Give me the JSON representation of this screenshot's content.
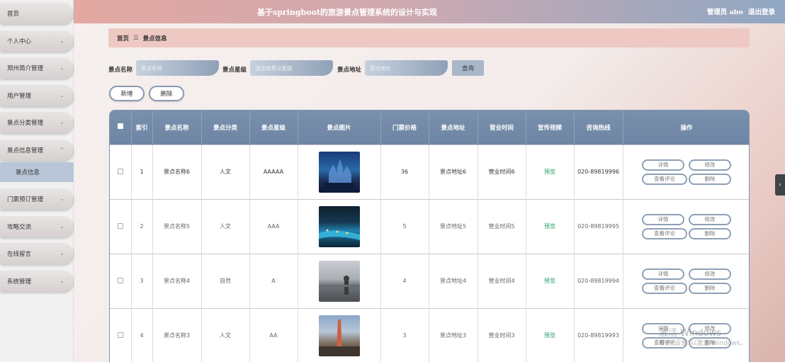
{
  "header": {
    "title": "基于springboot的旅游景点管理系统的设计与实现",
    "user_label": "管理员 abo",
    "logout": "退出登录"
  },
  "sidebar": {
    "items": [
      {
        "label": "首页",
        "expandable": false
      },
      {
        "label": "个人中心",
        "expandable": true
      },
      {
        "label": "郑州简介管理",
        "expandable": true
      },
      {
        "label": "用户管理",
        "expandable": true
      },
      {
        "label": "景点分类管理",
        "expandable": true
      },
      {
        "label": "景点信息管理",
        "expandable": true,
        "expanded": true
      },
      {
        "label": "门票预订管理",
        "expandable": true
      },
      {
        "label": "攻略交流",
        "expandable": true
      },
      {
        "label": "在线留言",
        "expandable": true
      },
      {
        "label": "系统管理",
        "expandable": true
      }
    ],
    "sub_item": "景点信息",
    "chevron_down": "⌄",
    "chevron_up": "^"
  },
  "breadcrumb": {
    "home": "首页",
    "sep": "☰",
    "current": "景点信息"
  },
  "search": {
    "name_label": "景点名称",
    "name_placeholder": "景点名称",
    "level_label": "景点星级",
    "level_placeholder": "请选择景点星级",
    "address_label": "景点地址",
    "address_placeholder": "景点地址",
    "query_button": "查询"
  },
  "actions": {
    "add": "新增",
    "delete": "删除"
  },
  "table": {
    "columns": [
      "索引",
      "景点名称",
      "景点分类",
      "景点星级",
      "景点图片",
      "门票价格",
      "景点地址",
      "营业时间",
      "宣传视频",
      "咨询热线",
      "操作"
    ],
    "rows": [
      {
        "index": "1",
        "name": "景点名称6",
        "category": "人文",
        "level": "AAAAA",
        "image": "castle-night",
        "price": "36",
        "address": "景点地址6",
        "hours": "营业时间6",
        "video": "预览",
        "phone": "020-89819996"
      },
      {
        "index": "2",
        "name": "景点名称5",
        "category": "人文",
        "level": "AAA",
        "image": "river-night",
        "price": "5",
        "address": "景点地址5",
        "hours": "营业时间5",
        "video": "预览",
        "phone": "020-89819995"
      },
      {
        "index": "3",
        "name": "景点名称4",
        "category": "自然",
        "level": "A",
        "image": "lake-statue",
        "price": "4",
        "address": "景点地址4",
        "hours": "营业时间4",
        "video": "预览",
        "phone": "020-89819994"
      },
      {
        "index": "4",
        "name": "景点名称3",
        "category": "人文",
        "level": "AA",
        "image": "tower-city",
        "price": "3",
        "address": "景点地址3",
        "hours": "营业时间3",
        "video": "预览",
        "phone": "020-89819993"
      }
    ],
    "row_actions": {
      "detail": "详情",
      "edit": "修改",
      "comments": "查看评论",
      "delete": "删除"
    }
  },
  "edge_tab": "‹",
  "watermark": {
    "line1": "激活 Windows",
    "line2": "转到\"设置\"以激活 Windows。"
  },
  "colors": {
    "header_start": "#e3a8a1",
    "header_end": "#8fa7c3",
    "table_header": "#7890ac",
    "link": "#1c9a5e"
  }
}
